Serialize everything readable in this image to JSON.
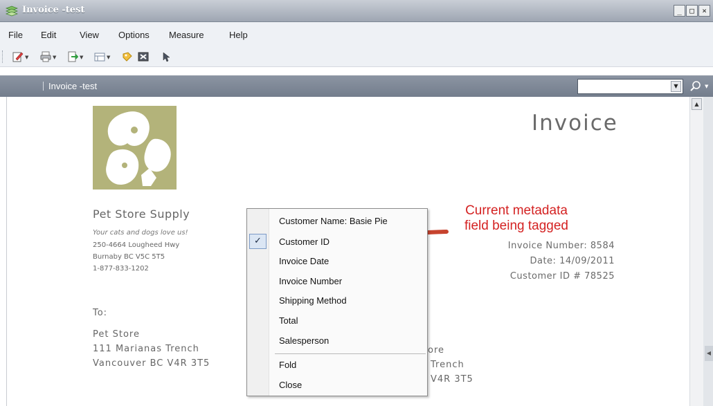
{
  "window": {
    "title": "Invoice -test"
  },
  "menu": [
    "File",
    "Edit",
    "View",
    "Options",
    "Measure",
    "Help"
  ],
  "toolbar": {
    "icons": [
      "edit-icon",
      "print-icon",
      "export-icon",
      "layout-icon",
      "tag-icon",
      "close-doc-icon",
      "pointer-icon"
    ]
  },
  "docbar": {
    "title": "Invoice -test",
    "search_value": ""
  },
  "invoice": {
    "heading": "Invoice",
    "company": "Pet Store Supply",
    "tagline": "Your cats and dogs love us!",
    "address_lines": [
      "250-4664 Lougheed Hwy",
      "Burnaby BC V5C 5T5",
      "1-877-833-1202"
    ],
    "invoice_number": "Invoice Number: 8584",
    "date": "Date: 14/09/2011",
    "customer_id": "Customer ID # 78525",
    "to_label": "To:",
    "to_lines": [
      "Pet Store",
      "111 Marianas Trench",
      "Vancouver BC V4R 3T5"
    ],
    "ship_lines": [
      "ore",
      "Trench",
      "V4R 3T5"
    ]
  },
  "context_menu": {
    "items": [
      "Customer Name: Basie Pie",
      "Customer ID",
      "Invoice Date",
      "Invoice Number",
      "Shipping Method",
      "Total",
      "Salesperson"
    ],
    "checked_index": 1,
    "check_glyph": "✓",
    "actions": [
      "Fold",
      "Close"
    ]
  },
  "annotation": {
    "line1": "Current metadata",
    "line2": "field being tagged",
    "color": "#d42222"
  },
  "colors": {
    "logo": "#b3b37a",
    "docbar": "#7f8898"
  }
}
